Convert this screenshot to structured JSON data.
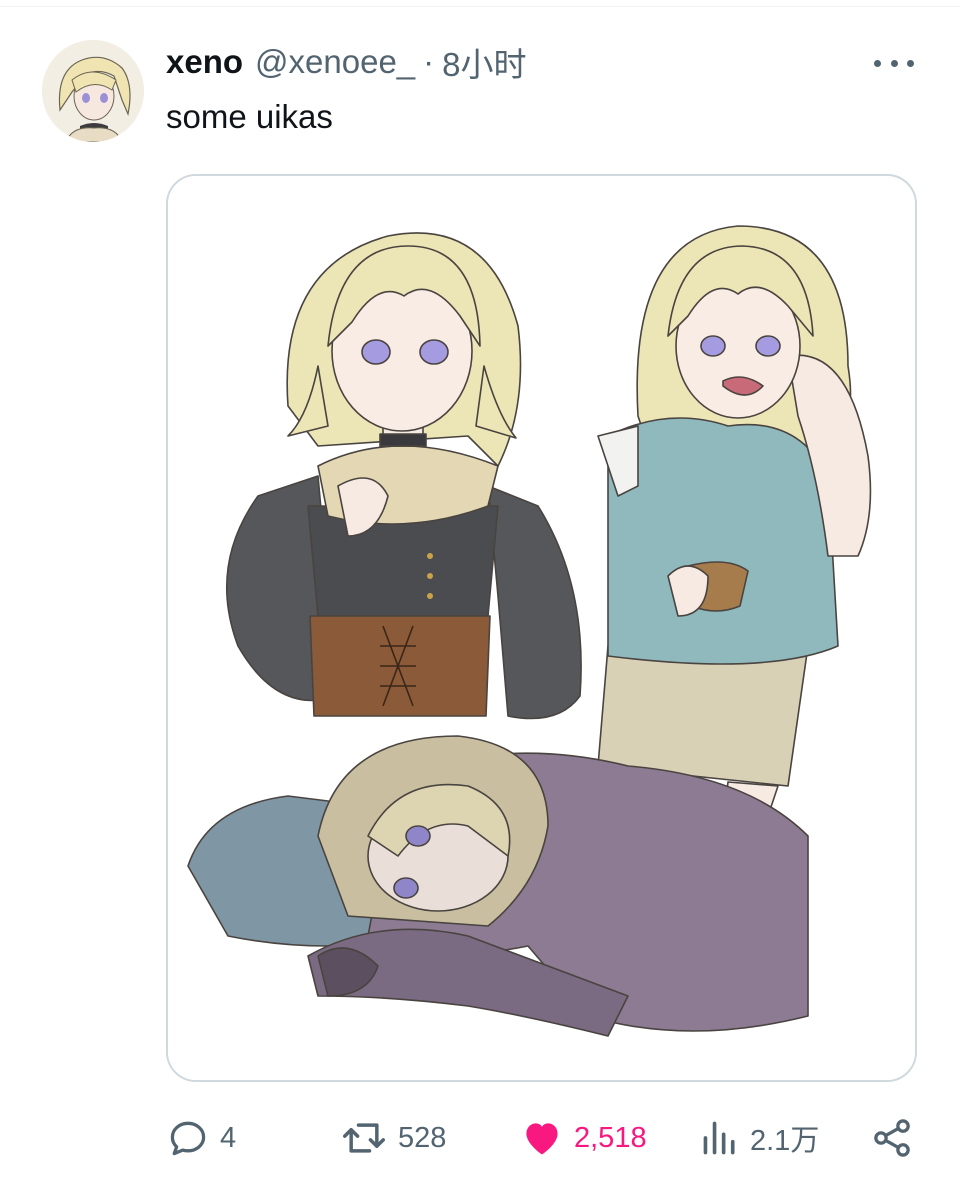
{
  "tweet": {
    "author_name": "xeno",
    "author_handle": "@xenoee_",
    "separator": "·",
    "time_ago": "8小时",
    "text": "some uikas"
  },
  "icons": {
    "more": "more-horizontal-icon",
    "reply": "reply-bubble-icon",
    "retweet": "retweet-icon",
    "like": "heart-filled-icon",
    "views": "bar-chart-icon",
    "share": "share-nodes-icon"
  },
  "actions": {
    "replies": "4",
    "retweets": "528",
    "likes": "2,518",
    "views": "2.1万"
  },
  "colors": {
    "text_primary": "#0f1419",
    "text_secondary": "#536471",
    "like_active": "#f91880",
    "media_border": "#cfd9de"
  }
}
